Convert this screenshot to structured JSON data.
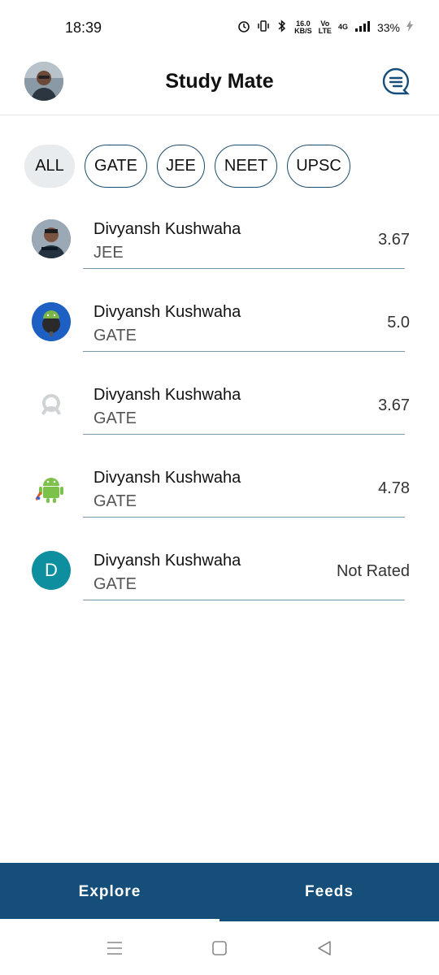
{
  "status_bar": {
    "time": "18:39",
    "speed_value": "16.0",
    "speed_unit": "KB/S",
    "volte_top": "Vo",
    "volte_bottom": "LTE",
    "network": "4G",
    "battery": "33%"
  },
  "header": {
    "title": "Study Mate",
    "accent_color": "#164e7a"
  },
  "filters": [
    {
      "label": "ALL",
      "active": true
    },
    {
      "label": "GATE",
      "active": false
    },
    {
      "label": "JEE",
      "active": false
    },
    {
      "label": "NEET",
      "active": false
    },
    {
      "label": "UPSC",
      "active": false
    }
  ],
  "users": [
    {
      "name": "Divyansh Kushwaha",
      "exam": "JEE",
      "rating": "3.67",
      "avatar": "photo"
    },
    {
      "name": "Divyansh Kushwaha",
      "exam": "GATE",
      "rating": "5.0",
      "avatar": "android-robot-blue"
    },
    {
      "name": "Divyansh Kushwaha",
      "exam": "GATE",
      "rating": "3.67",
      "avatar": "default-person"
    },
    {
      "name": "Divyansh Kushwaha",
      "exam": "GATE",
      "rating": "4.78",
      "avatar": "android-green"
    },
    {
      "name": "Divyansh Kushwaha",
      "exam": "GATE",
      "rating": "Not Rated",
      "avatar": "letter",
      "avatar_letter": "D"
    }
  ],
  "bottom_nav": {
    "tabs": [
      {
        "label": "Explore",
        "active": true
      },
      {
        "label": "Feeds",
        "active": false
      }
    ]
  },
  "system_nav": {
    "icons": [
      "menu-icon",
      "home-square-icon",
      "back-triangle-icon"
    ]
  }
}
